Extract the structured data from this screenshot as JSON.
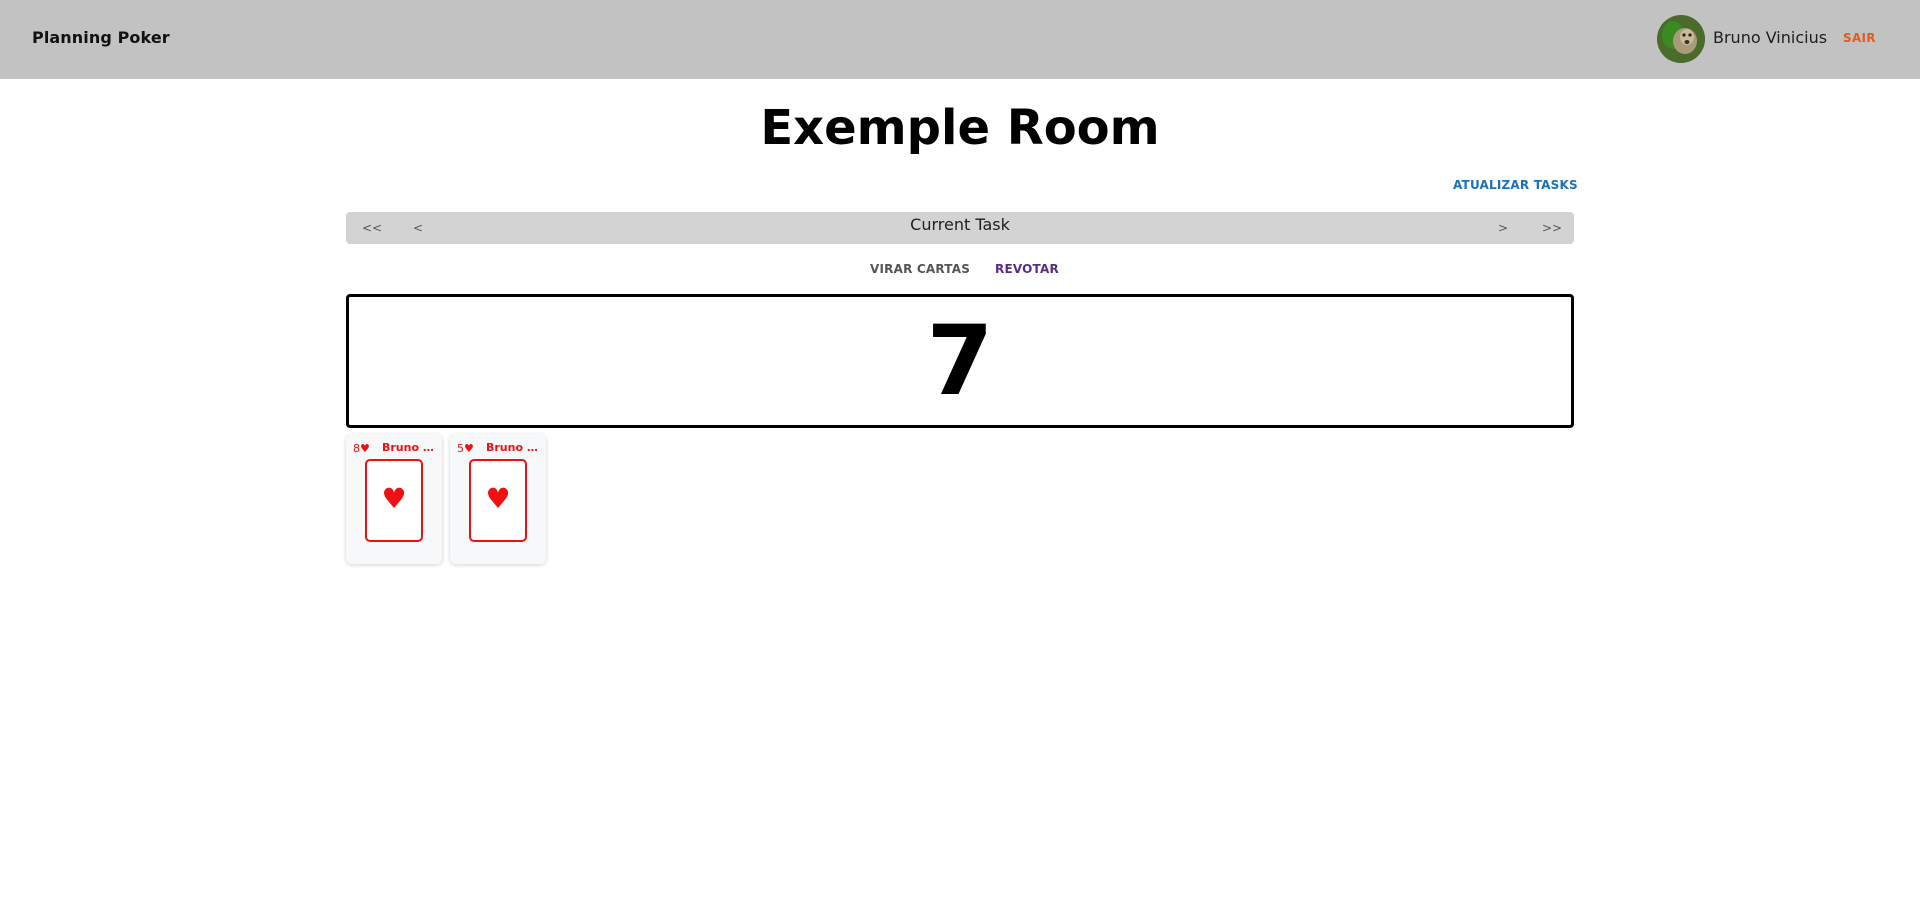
{
  "header": {
    "brand": "Planning Poker",
    "user_name": "Bruno Vinicius",
    "logout_label": "SAIR"
  },
  "room": {
    "title": "Exemple Room",
    "update_tasks_label": "ATUALIZAR TASKS"
  },
  "task_nav": {
    "first_label": "<<",
    "prev_label": "<",
    "current_task": "Current Task",
    "next_label": ">",
    "last_label": ">>"
  },
  "actions": {
    "flip_label": "VIRAR CARTAS",
    "revote_label": "REVOTAR"
  },
  "result": {
    "value": "7"
  },
  "cards": [
    {
      "value": "8♥",
      "owner": "Bruno Vinicius",
      "suit": "♥"
    },
    {
      "value": "5♥",
      "owner": "Bruno Vinicius",
      "suit": "♥"
    }
  ],
  "colors": {
    "header_bg": "#c2c2c2",
    "logout": "#e65a1e",
    "update_tasks": "#1b72b8",
    "revote": "#5b2c86",
    "card_red": "#ee1111"
  },
  "icons": {
    "card_suit": "heart-icon"
  }
}
